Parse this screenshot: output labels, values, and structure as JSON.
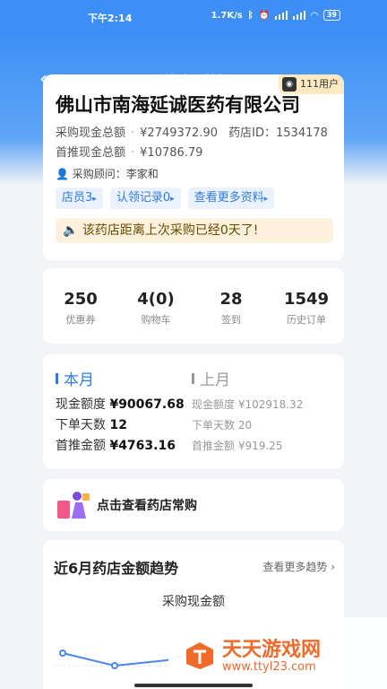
{
  "status_bar": {
    "time": "下午2:14",
    "speed": "1.7K/s",
    "battery": "39"
  },
  "header": {
    "title": "药店详情"
  },
  "store": {
    "user_badge": "111用户",
    "name": "佛山市南海延诚医药有限公司",
    "purchase_cash_total_label": "采购现金总额",
    "purchase_cash_total": "¥2749372.90",
    "store_id_label": "药店ID：",
    "store_id": "1534178",
    "first_push_total_label": "首推现金总额",
    "first_push_total": "¥10786.79",
    "advisor_label": "采购顾问：",
    "advisor_name": "李家和",
    "chips": [
      "店员3",
      "认领记录0",
      "查看更多资料"
    ],
    "notice": "该药店距离上次采购已经0天了!"
  },
  "stats": [
    {
      "value": "250",
      "label": "优惠券"
    },
    {
      "value": "4(0)",
      "label": "购物车"
    },
    {
      "value": "28",
      "label": "签到"
    },
    {
      "value": "1549",
      "label": "历史订单"
    }
  ],
  "this_month": {
    "title": "本月",
    "cash_label": "现金额度",
    "cash": "¥90067.68",
    "days_label": "下单天数",
    "days": "12",
    "push_label": "首推金额",
    "push": "¥4763.16"
  },
  "last_month": {
    "title": "上月",
    "cash_label": "现金额度",
    "cash": "¥102918.32",
    "days_label": "下单天数",
    "days": "20",
    "push_label": "首推金额",
    "push": "¥919.25"
  },
  "often_buy": {
    "label": "点击查看药店常购"
  },
  "trend": {
    "title": "近6月药店金额趋势",
    "more": "查看更多趋势",
    "more_arrow": "›",
    "chart_title": "采购现金额"
  },
  "watermark": {
    "title": "天天游戏网",
    "url": "www.ttyl23.com"
  },
  "colors": {
    "primary": "#3d8ff5",
    "accent_text": "#2f7be6",
    "badge_bg": "#ffe9c2",
    "notice_bg": "#fbf1dc",
    "watermark": "#f06a2a"
  }
}
